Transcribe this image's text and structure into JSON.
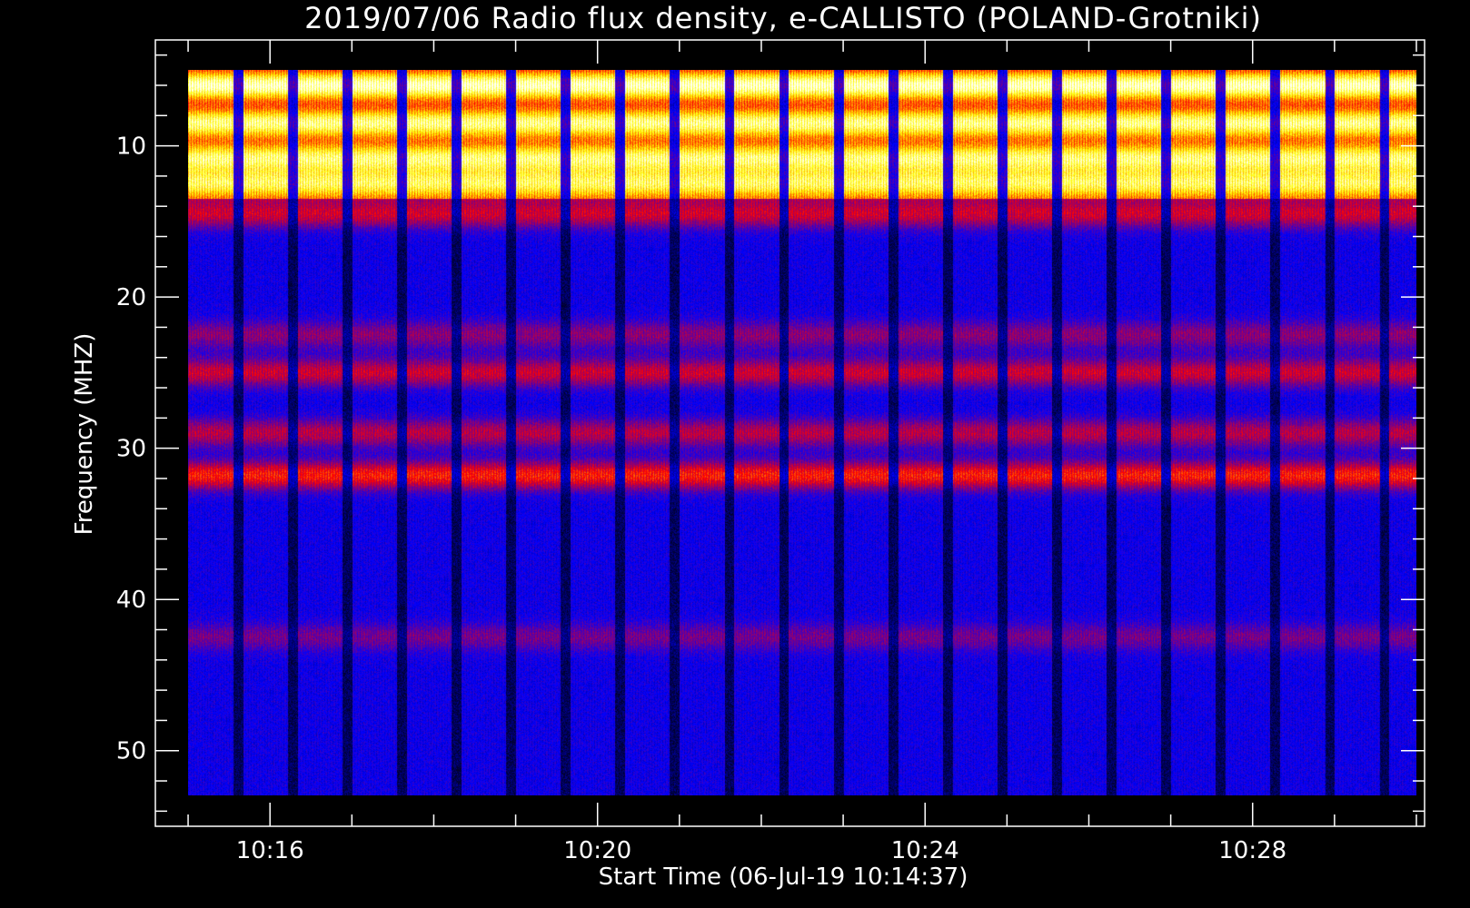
{
  "chart_data": {
    "type": "heatmap",
    "title": "2019/07/06  Radio flux density, e-CALLISTO (POLAND-Grotniki)",
    "xlabel": "Start Time (06-Jul-19 10:14:37)",
    "ylabel": "Frequency (MHZ)",
    "x_range_minutes": [
      14.6,
      30.1
    ],
    "x_data_range_minutes": [
      15.0,
      30.0
    ],
    "x_major_ticks_minutes": [
      16,
      20,
      24,
      28
    ],
    "x_tick_labels": [
      "10:16",
      "10:20",
      "10:24",
      "10:28"
    ],
    "x_minor_tick_step_minutes": 1,
    "y_range": [
      55,
      3
    ],
    "y_inverted": true,
    "y_data_range": [
      5.0,
      53.0
    ],
    "y_major_ticks": [
      10,
      20,
      30,
      40,
      50
    ],
    "y_tick_labels": [
      "10",
      "20",
      "30",
      "40",
      "50"
    ],
    "y_minor_tick_step": 2,
    "background_color": "#0000ff",
    "colormap": [
      "#000000",
      "#0000ff",
      "#ff0000",
      "#ffff00",
      "#ffffff"
    ],
    "emission_bands_mhz": [
      {
        "center": 6.0,
        "intensity": 0.95
      },
      {
        "center": 8.5,
        "intensity": 0.85
      },
      {
        "center": 10.8,
        "intensity": 0.8
      },
      {
        "center": 12.5,
        "intensity": 0.75
      },
      {
        "center": 14.5,
        "intensity": 0.45
      },
      {
        "center": 22.5,
        "intensity": 0.3
      },
      {
        "center": 25.0,
        "intensity": 0.45
      },
      {
        "center": 29.0,
        "intensity": 0.4
      },
      {
        "center": 31.8,
        "intensity": 0.6
      },
      {
        "center": 42.5,
        "intensity": 0.25
      }
    ]
  }
}
